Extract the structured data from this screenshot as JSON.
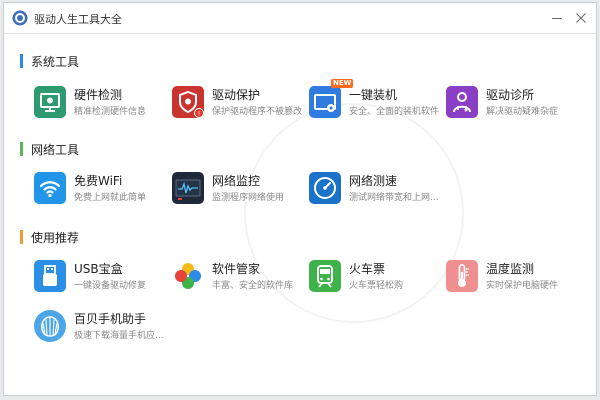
{
  "window": {
    "title": "驱动人生工具大全"
  },
  "sections": [
    {
      "label": "系统工具",
      "accent": "#2a8be6",
      "tools": [
        {
          "name": "硬件检测",
          "desc": "精准检测硬件信息",
          "icon": "monitor-icon",
          "color": "#2d9b6f"
        },
        {
          "name": "驱动保护",
          "desc": "保护驱动程序不被篡改",
          "icon": "shield-icon",
          "color": "#c9342f"
        },
        {
          "name": "一键装机",
          "desc": "安全、全面的装机软件",
          "icon": "install-icon",
          "color": "#2f7be0",
          "badge": "NEW"
        },
        {
          "name": "驱动诊所",
          "desc": "解决驱动疑难杂症",
          "icon": "doctor-icon",
          "color": "#8b3fc6"
        }
      ]
    },
    {
      "label": "网络工具",
      "accent": "#5cb85c",
      "tools": [
        {
          "name": "免费WiFi",
          "desc": "免费上网就此简单",
          "icon": "wifi-icon",
          "color": "#2196e8"
        },
        {
          "name": "网络监控",
          "desc": "监测程序网络使用",
          "icon": "network-monitor-icon",
          "color": "#1e2a3a"
        },
        {
          "name": "网络测速",
          "desc": "测试网络带宽和上网...",
          "icon": "speedometer-icon",
          "color": "#1a73c9"
        }
      ]
    },
    {
      "label": "使用推荐",
      "accent": "#f39c2b",
      "tools": [
        {
          "name": "USB宝盒",
          "desc": "一键设备驱动修复",
          "icon": "usb-icon",
          "color": "#2b8fe6"
        },
        {
          "name": "软件管家",
          "desc": "丰富、安全的软件库",
          "icon": "software-manager-icon",
          "color": "#ffffff"
        },
        {
          "name": "火车票",
          "desc": "火车票轻松购",
          "icon": "train-icon",
          "color": "#3db34a"
        },
        {
          "name": "温度监测",
          "desc": "实时保护电脑硬件",
          "icon": "thermometer-icon",
          "color": "#f08f8f"
        },
        {
          "name": "百贝手机助手",
          "desc": "极速下载海量手机应...",
          "icon": "shell-icon",
          "color": "#4aa6e8"
        }
      ]
    }
  ]
}
